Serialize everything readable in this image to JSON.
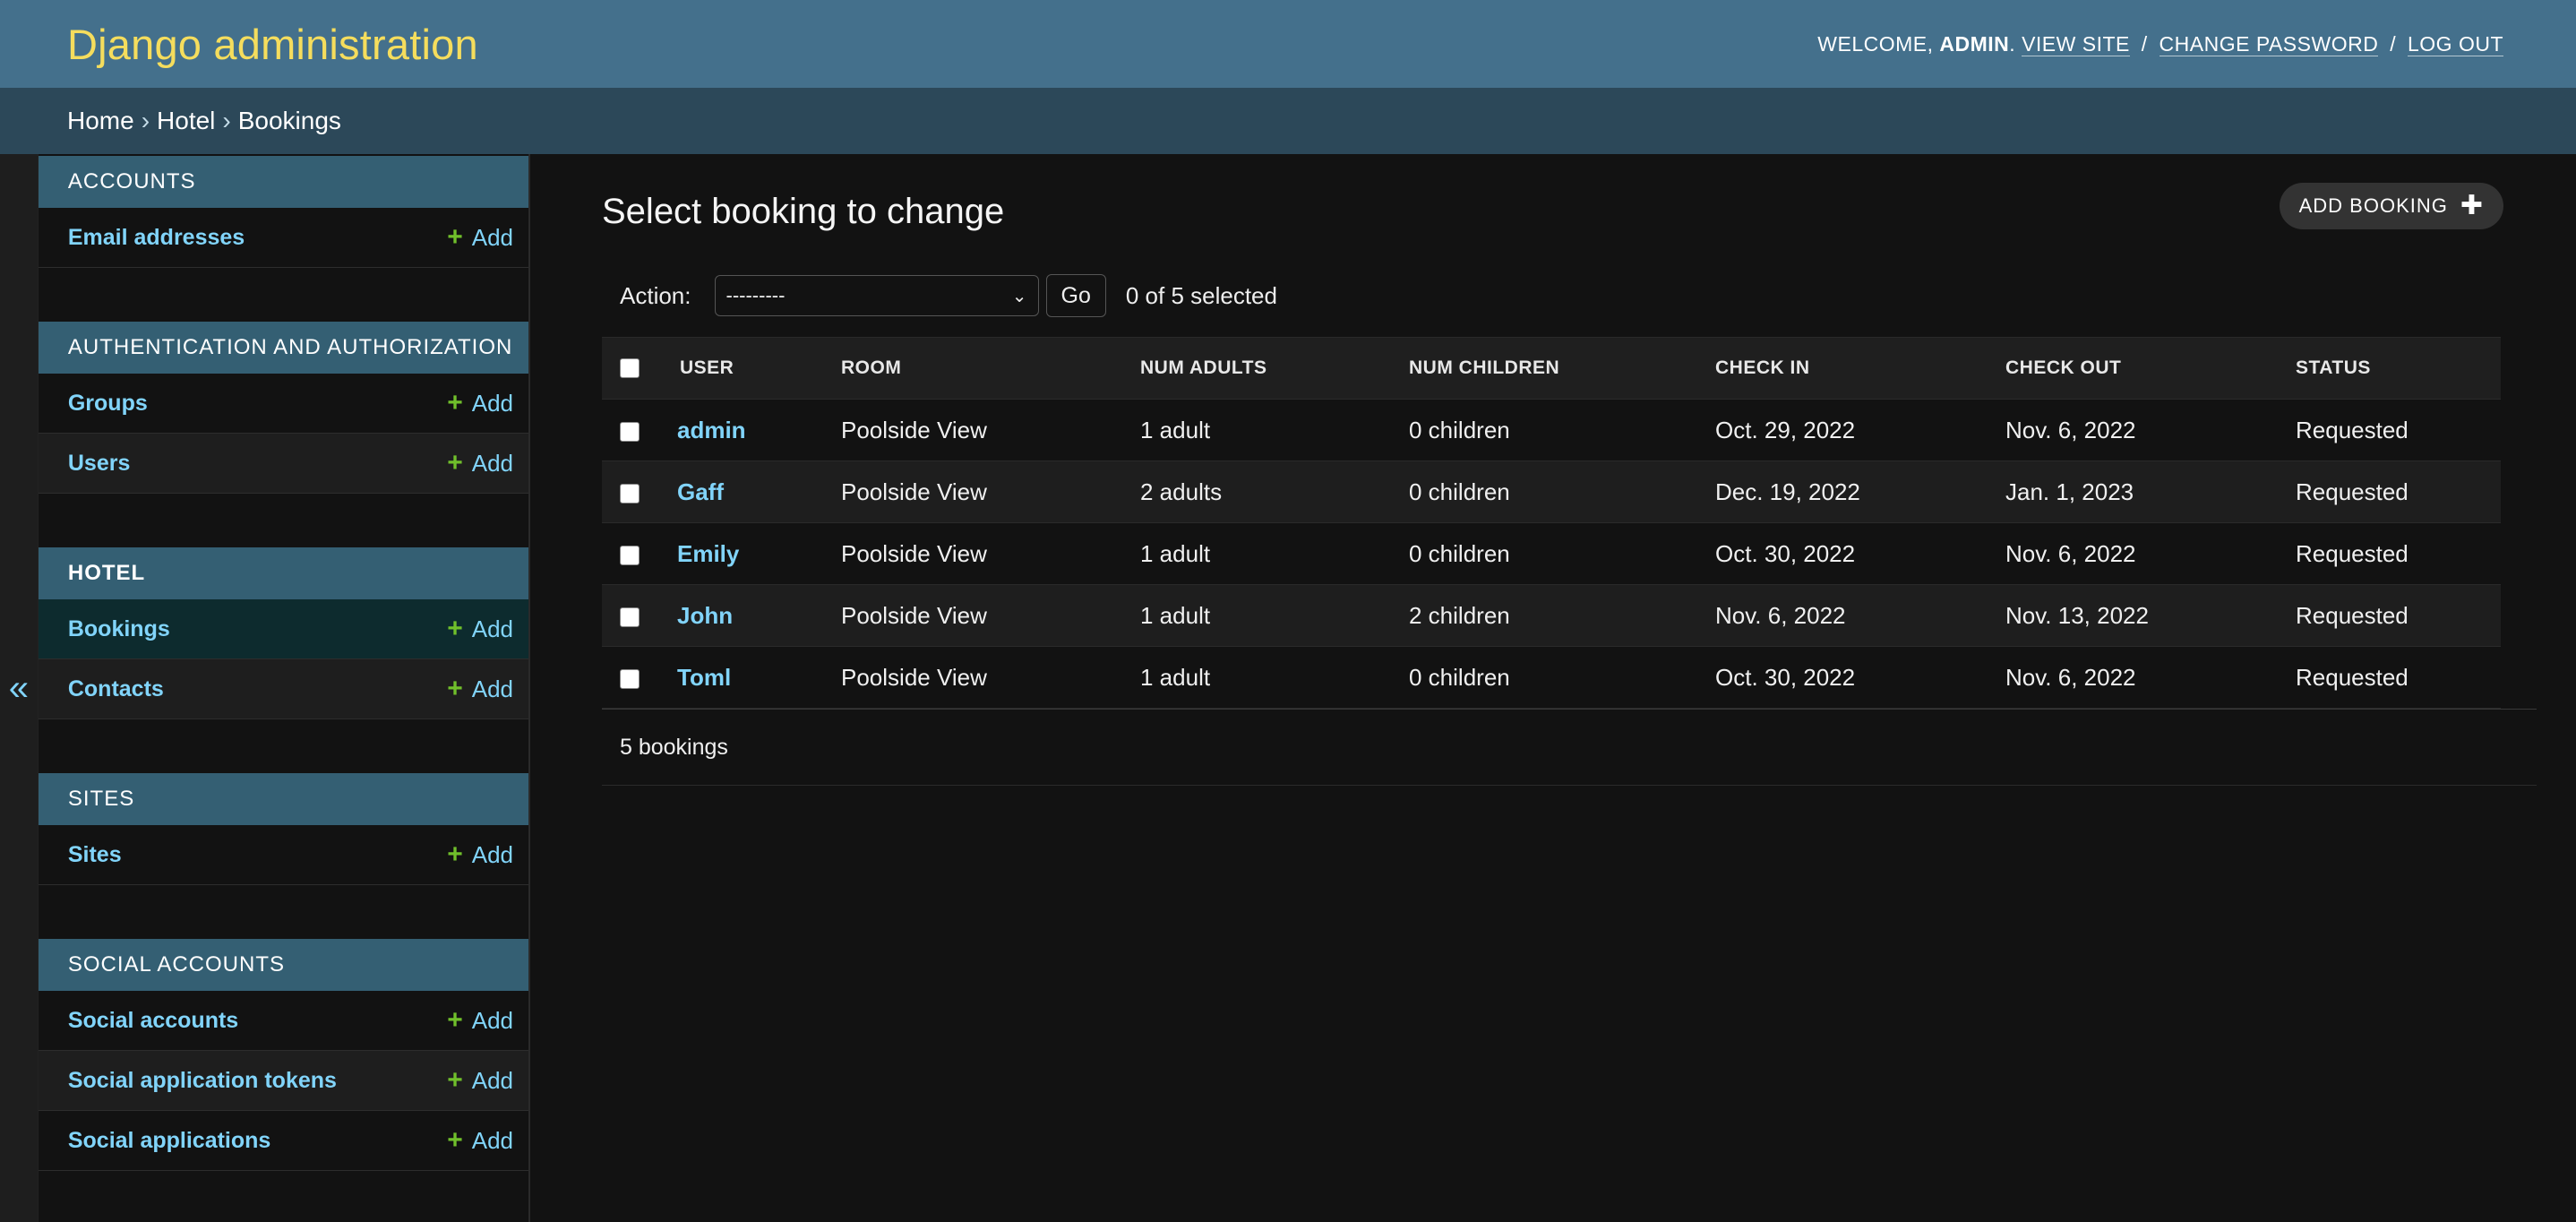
{
  "header": {
    "brand": "Django administration",
    "welcome": "WELCOME,",
    "username": "ADMIN",
    "view_site": "VIEW SITE",
    "change_password": "CHANGE PASSWORD",
    "log_out": "LOG OUT",
    "sep1": "/",
    "sep2": "/",
    "period": "."
  },
  "breadcrumbs": {
    "home": "Home",
    "app": "Hotel",
    "current": "Bookings",
    "sep": "›"
  },
  "sidebar": {
    "toggle": "«",
    "add_label": "Add",
    "modules": [
      {
        "caption": "ACCOUNTS",
        "models": [
          "Email addresses"
        ]
      },
      {
        "caption": "AUTHENTICATION AND AUTHORIZATION",
        "models": [
          "Groups",
          "Users"
        ]
      },
      {
        "caption": "HOTEL",
        "models": [
          "Bookings",
          "Contacts"
        ]
      },
      {
        "caption": "SITES",
        "models": [
          "Sites"
        ]
      },
      {
        "caption": "SOCIAL ACCOUNTS",
        "models": [
          "Social accounts",
          "Social application tokens",
          "Social applications"
        ]
      }
    ]
  },
  "content": {
    "title": "Select booking to change",
    "add_button": "ADD BOOKING",
    "action_label": "Action:",
    "action_selected": "---------",
    "go_button": "Go",
    "selected_count": "0 of 5 selected",
    "columns": [
      "USER",
      "ROOM",
      "NUM ADULTS",
      "NUM CHILDREN",
      "CHECK IN",
      "CHECK OUT",
      "STATUS"
    ],
    "rows": [
      [
        "admin",
        "Poolside View",
        "1 adult",
        "0 children",
        "Oct. 29, 2022",
        "Nov. 6, 2022",
        "Requested"
      ],
      [
        "Gaff",
        "Poolside View",
        "2 adults",
        "0 children",
        "Dec. 19, 2022",
        "Jan. 1, 2023",
        "Requested"
      ],
      [
        "Emily",
        "Poolside View",
        "1 adult",
        "0 children",
        "Oct. 30, 2022",
        "Nov. 6, 2022",
        "Requested"
      ],
      [
        "John",
        "Poolside View",
        "1 adult",
        "2 children",
        "Nov. 6, 2022",
        "Nov. 13, 2022",
        "Requested"
      ],
      [
        "Toml",
        "Poolside View",
        "1 adult",
        "0 children",
        "Oct. 30, 2022",
        "Nov. 6, 2022",
        "Requested"
      ]
    ],
    "paginator": "5 bookings"
  },
  "colors": {
    "header_bg": "#44708c",
    "brand": "#f5dd5d",
    "link": "#81d4fa",
    "add_plus": "#70bf2b",
    "background": "#121212"
  }
}
